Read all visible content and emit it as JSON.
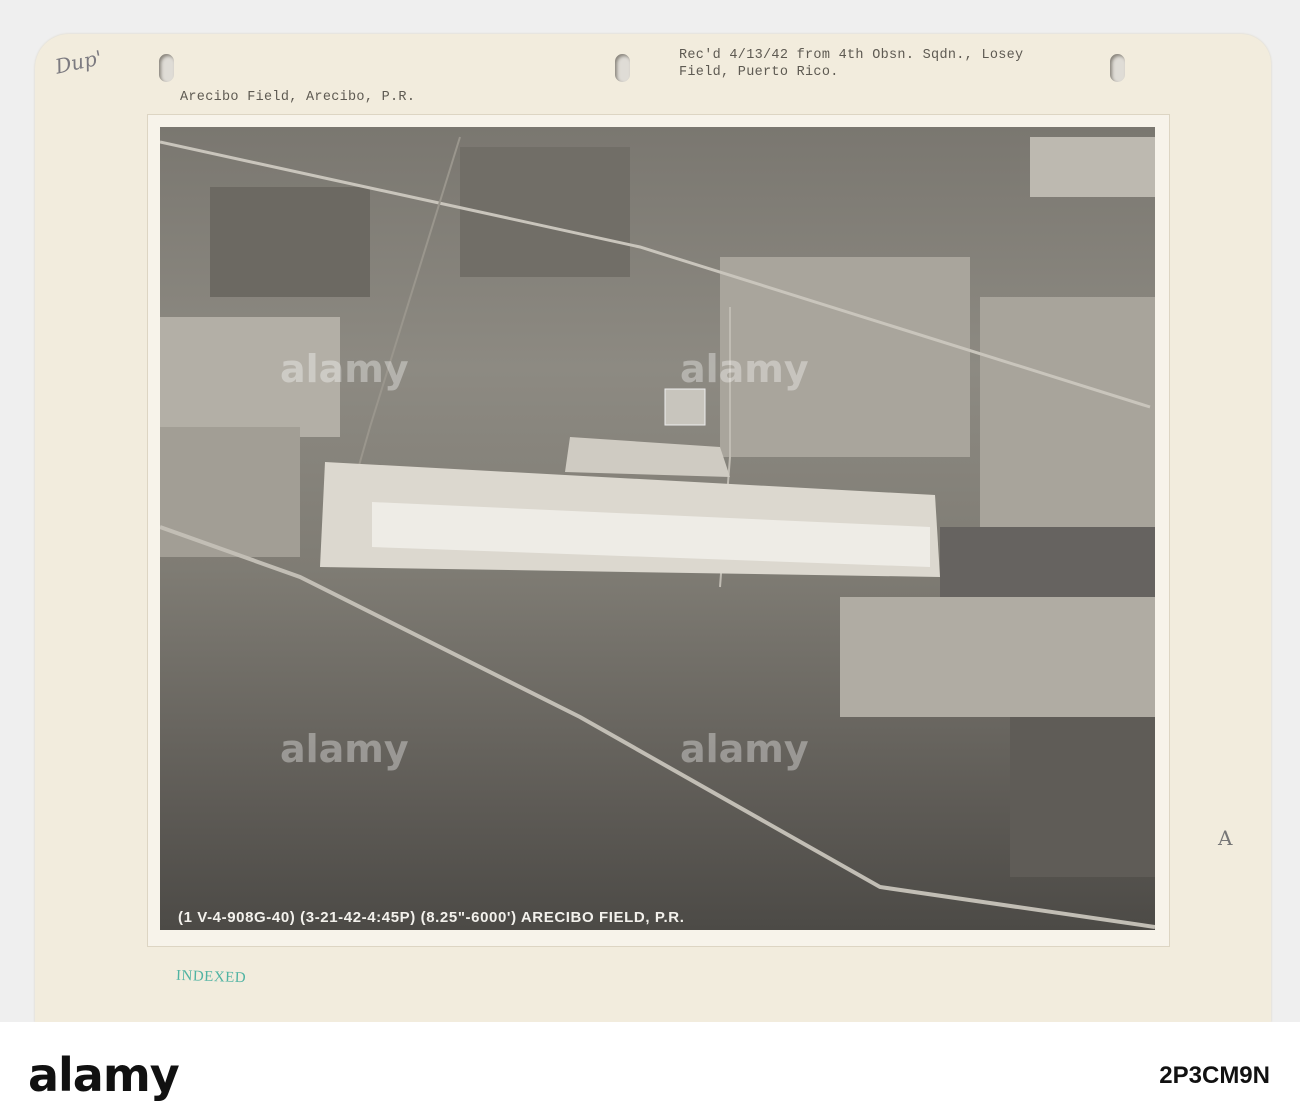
{
  "card": {
    "handwritten_note": "Dup'",
    "handwritten_margin_mark": "A",
    "location_label": "Arecibo Field, Arecibo, P.R.",
    "received_note_line1": "Rec'd 4/13/42 from 4th Obsn. Sqdn., Losey",
    "received_note_line2": "Field, Puerto Rico.",
    "stamp": "INDEXED"
  },
  "photo": {
    "caption": "(1 V-4-908G-40) (3-21-42-4:45P) (8.25\"-6000') ARECIBO FIELD, P.R."
  },
  "watermark": {
    "text": "alamy"
  },
  "footer": {
    "logo": "alamy",
    "image_id": "2P3CM9N"
  }
}
